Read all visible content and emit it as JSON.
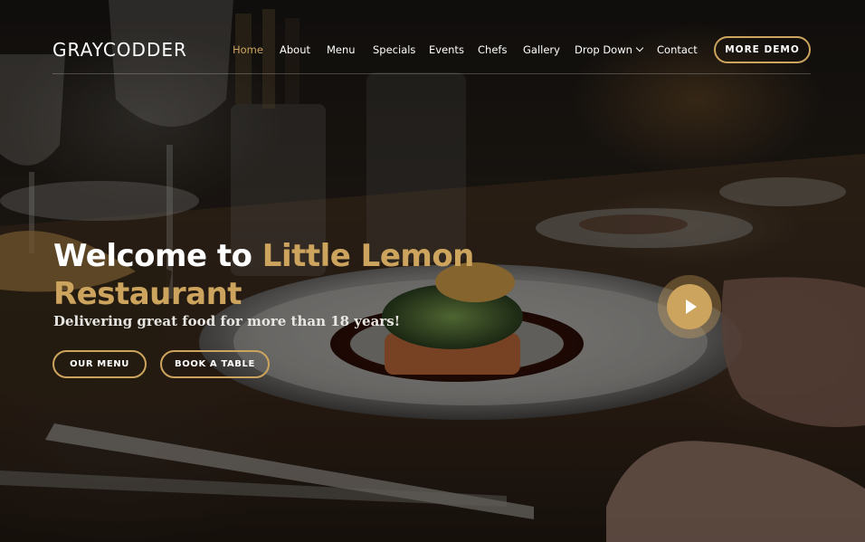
{
  "header": {
    "logo": "GRAYCODDER",
    "nav": [
      {
        "label": "Home",
        "active": true
      },
      {
        "label": "About"
      },
      {
        "label": "Menu"
      },
      {
        "label": "Specials"
      },
      {
        "label": "Events"
      },
      {
        "label": "Chefs"
      },
      {
        "label": "Gallery"
      },
      {
        "label": "Drop Down",
        "dropdown": true
      },
      {
        "label": "Contact"
      }
    ],
    "cta_label": "MORE DEMO"
  },
  "hero": {
    "headline_prefix": "Welcome to ",
    "headline_accent": "Little Lemon Restaurant",
    "tagline": "Delivering great food for more than 18 years!",
    "buttons": {
      "menu_label": "OUR MENU",
      "table_label": "BOOK A TABLE"
    },
    "play_icon": "play-icon"
  },
  "colors": {
    "accent": "#cda45e",
    "text": "#ffffff"
  }
}
